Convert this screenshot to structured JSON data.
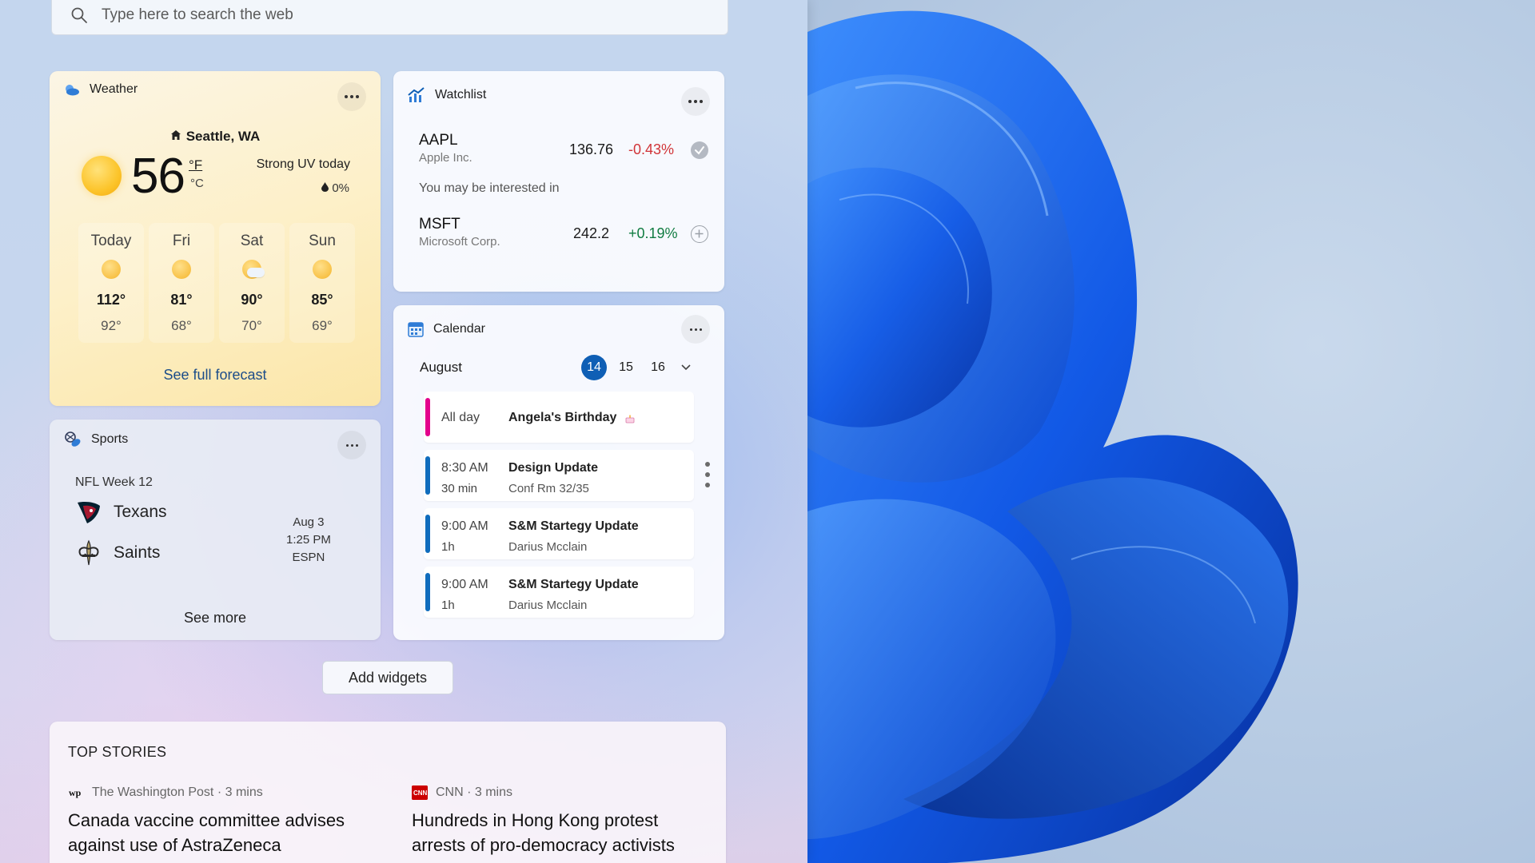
{
  "search": {
    "placeholder": "Type here to search the web"
  },
  "weather": {
    "title": "Weather",
    "location": "Seattle, WA",
    "temperature": "56",
    "unit_f": "°F",
    "unit_c": "°C",
    "condition": "Strong UV today",
    "precipitation": "0%",
    "forecast": [
      {
        "day": "Today",
        "high": "112°",
        "low": "92°",
        "icon": "sun-icon"
      },
      {
        "day": "Fri",
        "high": "81°",
        "low": "68°",
        "icon": "sun-icon"
      },
      {
        "day": "Sat",
        "high": "90°",
        "low": "70°",
        "icon": "partly-cloudy-icon"
      },
      {
        "day": "Sun",
        "high": "85°",
        "low": "69°",
        "icon": "sun-icon"
      }
    ],
    "link": "See full forecast"
  },
  "watchlist": {
    "title": "Watchlist",
    "stocks": [
      {
        "symbol": "AAPL",
        "company": "Apple Inc.",
        "price": "136.76",
        "change": "-0.43%",
        "change_color": "#d13438",
        "status": "check-icon"
      },
      {
        "symbol": "MSFT",
        "company": "Microsoft Corp.",
        "price": "242.2",
        "change": "+0.19%",
        "change_color": "#107c41",
        "status": "add-icon"
      }
    ],
    "interest_label": "You may be interested in"
  },
  "calendar": {
    "title": "Calendar",
    "month": "August",
    "dates": [
      "14",
      "15",
      "16"
    ],
    "selected_date": "14",
    "events": [
      {
        "time": "All day",
        "duration": "",
        "title": "Angela's Birthday",
        "subtitle": "",
        "color": "#e3008c",
        "icon": "cake-icon"
      },
      {
        "time": "8:30 AM",
        "duration": "30 min",
        "title": "Design Update",
        "subtitle": "Conf Rm 32/35",
        "color": "#0f6cbd"
      },
      {
        "time": "9:00 AM",
        "duration": "1h",
        "title": "S&M Startegy Update",
        "subtitle": "Darius Mcclain",
        "color": "#0f6cbd"
      },
      {
        "time": "9:00 AM",
        "duration": "1h",
        "title": "S&M Startegy Update",
        "subtitle": "Darius Mcclain",
        "color": "#0f6cbd"
      }
    ]
  },
  "sports": {
    "title": "Sports",
    "week": "NFL Week 12",
    "teams": [
      {
        "name": "Texans",
        "icon": "texans-logo-icon"
      },
      {
        "name": "Saints",
        "icon": "saints-logo-icon"
      }
    ],
    "date": "Aug 3",
    "time": "1:25 PM",
    "channel": "ESPN",
    "link": "See more"
  },
  "add_widgets": "Add widgets",
  "stories": {
    "title": "TOP STORIES",
    "items": [
      {
        "source": "The Washington Post · 3 mins",
        "headline": "Canada vaccine committee advises against use of AstraZeneca",
        "logo": "wp"
      },
      {
        "source": "CNN · 3 mins",
        "headline": "Hundreds in Hong Kong protest arrests of pro-democracy activists",
        "logo": "CNN"
      }
    ]
  },
  "colors": {
    "accent": "#0f5fb5",
    "positive": "#107c41",
    "negative": "#d13438",
    "wallpaper_blue": "#1a5fe0"
  }
}
